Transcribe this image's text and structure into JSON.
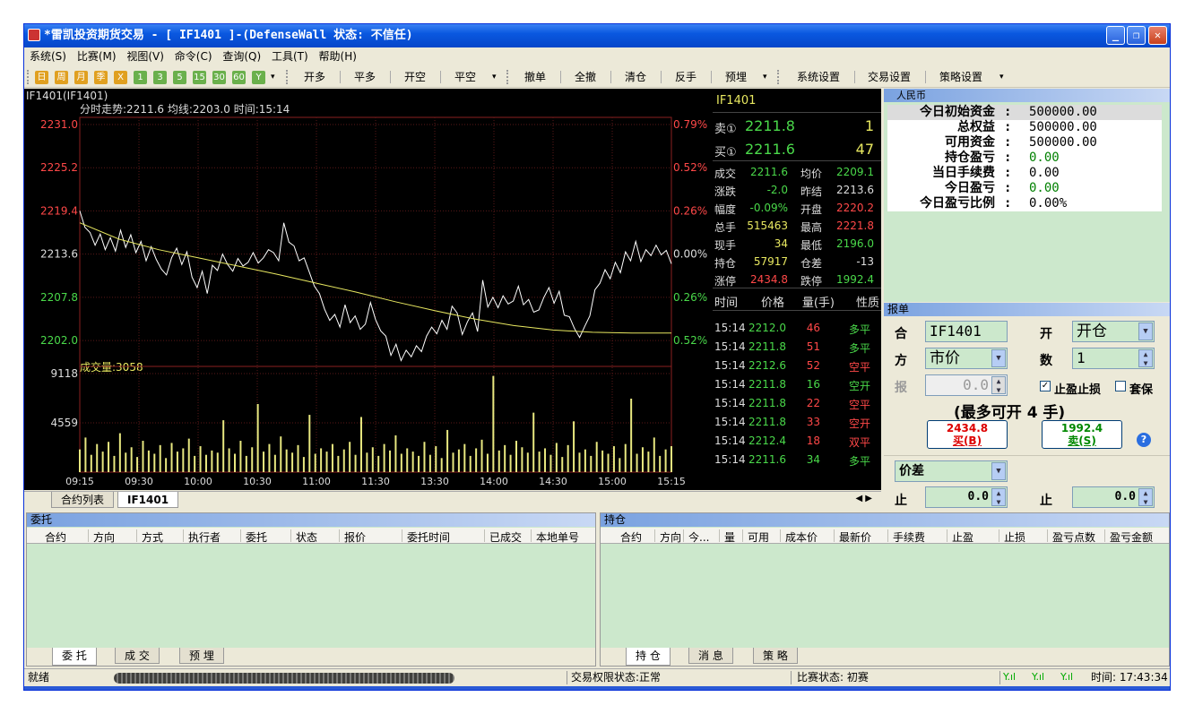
{
  "window": {
    "title": "*雷凯投资期货交易  - [  IF1401  ]-(DefenseWall 状态: 不信任)"
  },
  "menu": [
    "系统(S)",
    "比赛(M)",
    "视图(V)",
    "命令(C)",
    "查询(Q)",
    "工具(T)",
    "帮助(H)"
  ],
  "toolbar": {
    "periods": [
      "日",
      "周",
      "月",
      "季",
      "X",
      "1",
      "3",
      "5",
      "15",
      "30",
      "60",
      "Y"
    ],
    "trade_buttons": [
      "开多",
      "平多",
      "开空",
      "平空"
    ],
    "order_buttons": [
      "撤单",
      "全撤",
      "清仓",
      "反手",
      "预埋"
    ],
    "settings_buttons": [
      "系统设置",
      "交易设置",
      "策略设置"
    ]
  },
  "chart_header": {
    "contract": "IF1401(IF1401)",
    "info": "分时走势:2211.6 均线:2203.0 时间:15:14",
    "volume_label": "成交量:3058"
  },
  "chart_data": {
    "type": "line",
    "price_ticks": [
      "2231.0",
      "2225.2",
      "2219.4",
      "2213.6",
      "2207.8",
      "2202.0"
    ],
    "percent_ticks": [
      "0.79%",
      "0.52%",
      "0.26%",
      "0.00%",
      "0.26%",
      "0.52%"
    ],
    "volume_ticks": [
      "9118",
      "4559"
    ],
    "time_ticks": [
      "09:15",
      "09:30",
      "10:00",
      "10:30",
      "11:00",
      "11:30",
      "13:30",
      "14:00",
      "14:30",
      "15:00",
      "15:15"
    ],
    "ylim": [
      2199,
      2231
    ],
    "volume_max": 9118,
    "grid": true,
    "series": [
      {
        "name": "分时走势",
        "color": "#ffffff",
        "values": [
          2219.4,
          2217.2,
          2216.5,
          2214.8,
          2216.3,
          2214.2,
          2215.8,
          2214.0,
          2216.8,
          2214.5,
          2216.2,
          2213.8,
          2215.3,
          2212.7,
          2214.6,
          2212.9,
          2211.6,
          2210.8,
          2213.1,
          2214.4,
          2212.2,
          2213.9,
          2210.5,
          2209.1,
          2211.3,
          2208.3,
          2212.1,
          2211.4,
          2213.6,
          2212.2,
          2211.3,
          2213.0,
          2212.0,
          2212.5,
          2213.8,
          2212.4,
          2213.1,
          2214.2,
          2213.8,
          2212.7,
          2217.8,
          2215.2,
          2214.7,
          2212.7,
          2213.1,
          2211.2,
          2209.3,
          2208.3,
          2206.2,
          2204.7,
          2205.5,
          2203.8,
          2206.8,
          2204.4,
          2205.3,
          2203.5,
          2204.2,
          2207.1,
          2204.8,
          2203.3,
          2202.6,
          2200.0,
          2201.5,
          2199.3,
          2200.7,
          2199.8,
          2201.3,
          2200.5,
          2202.6,
          2203.8,
          2202.9,
          2204.7,
          2203.5,
          2206.6,
          2205.7,
          2202.8,
          2204.5,
          2205.7,
          2203.2,
          2210.1,
          2206.5,
          2207.8,
          2206.4,
          2208.0,
          2206.9,
          2207.3,
          2209.3,
          2206.8,
          2207.5,
          2205.8,
          2206.1,
          2207.8,
          2209.1,
          2207.0,
          2208.6,
          2205.4,
          2205.2,
          2203.6,
          2202.4,
          2203.9,
          2205.3,
          2208.8,
          2209.7,
          2211.5,
          2210.3,
          2212.5,
          2211.1,
          2213.9,
          2212.7,
          2215.3,
          2212.6,
          2214.2,
          2213.4,
          2214.8,
          2213.5,
          2214.1,
          2212.3
        ]
      },
      {
        "name": "均线",
        "color": "#e8e860",
        "values": [
          2217.8,
          2215.6,
          2214.2,
          2213.1,
          2212.0,
          2210.9,
          2209.7,
          2208.5,
          2207.2,
          2206.0,
          2204.9,
          2204.0,
          2203.4,
          2203.1,
          2203.0,
          2203.0
        ]
      },
      {
        "name": "成交量",
        "color": "#e8e880",
        "values": [
          2100,
          3200,
          1600,
          2600,
          1900,
          2800,
          1500,
          3600,
          1800,
          2300,
          1400,
          2900,
          2000,
          1700,
          2500,
          1300,
          2700,
          1900,
          2200,
          3100,
          1500,
          2400,
          1600,
          2000,
          1800,
          4800,
          2200,
          1700,
          2900,
          1500,
          2300,
          6300,
          1900,
          2600,
          1600,
          3300,
          2100,
          1800,
          2500,
          1400,
          5300,
          1700,
          2200,
          1900,
          2600,
          1500,
          2100,
          2800,
          1600,
          5100,
          1800,
          2300,
          1500,
          2600,
          2000,
          3400,
          1700,
          2200,
          1900,
          1500,
          2800,
          1600,
          2400,
          1300,
          3900,
          1800,
          2100,
          2600,
          1500,
          2200,
          3000,
          1700,
          8900,
          2000,
          2500,
          1600,
          2900,
          2300,
          1800,
          5500,
          1900,
          2200,
          1600,
          2700,
          1400,
          2500,
          4700,
          1800,
          2100,
          1500,
          2800,
          2000,
          1700,
          2400,
          1300,
          2600,
          6800,
          1700,
          2300,
          1900,
          3200,
          1500,
          2100,
          2400
        ]
      }
    ]
  },
  "quote": {
    "symbol": "IF1401",
    "ask_label": "卖①",
    "ask_price": "2211.8",
    "ask_vol": "1",
    "bid_label": "买①",
    "bid_price": "2211.6",
    "bid_vol": "47",
    "rows": [
      [
        "成交",
        "2211.6",
        "均价",
        "2209.1"
      ],
      [
        "涨跌",
        "-2.0",
        "昨结",
        "2213.6"
      ],
      [
        "幅度",
        "-0.09%",
        "开盘",
        "2220.2"
      ],
      [
        "总手",
        "515463",
        "最高",
        "2221.8"
      ],
      [
        "现手",
        "34",
        "最低",
        "2196.0"
      ],
      [
        "持仓",
        "57917",
        "仓差",
        "-13"
      ],
      [
        "涨停",
        "2434.8",
        "跌停",
        "1992.4"
      ]
    ],
    "row_colors": [
      [
        "#4ad94a",
        "#4ad94a"
      ],
      [
        "#4ad94a",
        "#dddddd"
      ],
      [
        "#4ad94a",
        "#ff4848"
      ],
      [
        "#e8e860",
        "#ff4848"
      ],
      [
        "#e8e860",
        "#4ad94a"
      ],
      [
        "#e8e860",
        "#dddddd"
      ],
      [
        "#ff4848",
        "#4ad94a"
      ]
    ],
    "tick_header": [
      "时间",
      "价格",
      "量(手)",
      "性质"
    ],
    "ticks": [
      [
        "15:14",
        "2212.0",
        "46",
        "多平"
      ],
      [
        "15:14",
        "2211.8",
        "51",
        "多平"
      ],
      [
        "15:14",
        "2212.6",
        "52",
        "空平"
      ],
      [
        "15:14",
        "2211.8",
        "16",
        "空开"
      ],
      [
        "15:14",
        "2211.8",
        "22",
        "空平"
      ],
      [
        "15:14",
        "2211.8",
        "33",
        "空开"
      ],
      [
        "15:14",
        "2212.4",
        "18",
        "双平"
      ],
      [
        "15:14",
        "2211.6",
        "34",
        "多平"
      ]
    ],
    "tick_colors": [
      [
        "#4ad94a",
        "#ff4848",
        "#4ad94a"
      ],
      [
        "#4ad94a",
        "#ff4848",
        "#4ad94a"
      ],
      [
        "#4ad94a",
        "#ff4848",
        "#ff4848"
      ],
      [
        "#4ad94a",
        "#4ad94a",
        "#4ad94a"
      ],
      [
        "#4ad94a",
        "#ff4848",
        "#ff4848"
      ],
      [
        "#4ad94a",
        "#ff4848",
        "#ff4848"
      ],
      [
        "#4ad94a",
        "#ff4848",
        "#ff4848"
      ],
      [
        "#4ad94a",
        "#4ad94a",
        "#4ad94a"
      ]
    ]
  },
  "account": {
    "currency": "人民币",
    "rows": [
      {
        "label": "今日初始资金",
        "value": "500000.00"
      },
      {
        "label": "总权益",
        "value": "500000.00"
      },
      {
        "label": "可用资金",
        "value": "500000.00"
      },
      {
        "label": "持仓盈亏",
        "value": "0.00"
      },
      {
        "label": "当日手续费",
        "value": "0.00"
      },
      {
        "label": "今日盈亏",
        "value": "0.00"
      },
      {
        "label": "今日盈亏比例",
        "value": "0.00%"
      }
    ]
  },
  "order_form": {
    "title": "报单",
    "contract_label": "合",
    "contract_value": "IF1401",
    "open_label": "开",
    "open_value": "开仓",
    "dir_label": "方",
    "dir_value": "市价",
    "qty_label": "数",
    "qty_value": "1",
    "price_label": "报",
    "price_value": "0.0",
    "stop_check": "止盈止损",
    "hedge_check": "套保",
    "max_text": "(最多可开 4 手)",
    "buy_price": "2434.8",
    "buy_label": "买(B)",
    "sell_price": "1992.4",
    "sell_label": "卖(S)",
    "spread_value": "价差",
    "stop1_label": "止",
    "stop1_value": "0.0",
    "stop2_label": "止",
    "stop2_value": "0.0"
  },
  "chart_tabs": [
    "合约列表",
    "IF1401"
  ],
  "orders_panel": {
    "title": "委托",
    "columns": [
      "合约",
      "方向",
      "方式",
      "执行者",
      "委托",
      "状态",
      "报价",
      "委托时间",
      "已成交",
      "本地单号"
    ],
    "tabs": [
      "委 托",
      "成 交",
      "预 埋"
    ]
  },
  "positions_panel": {
    "title": "持仓",
    "columns": [
      "合约",
      "方向",
      "今...",
      "量",
      "可用",
      "成本价",
      "最新价",
      "手续费",
      "止盈",
      "止损",
      "盈亏点数",
      "盈亏金额"
    ],
    "tabs": [
      "持 仓",
      "消 息",
      "策 略"
    ]
  },
  "status": {
    "ready": "就绪",
    "trade_perm": "交易权限状态:正常",
    "match": "比赛状态: 初赛",
    "time": "时间: 17:43:34"
  }
}
